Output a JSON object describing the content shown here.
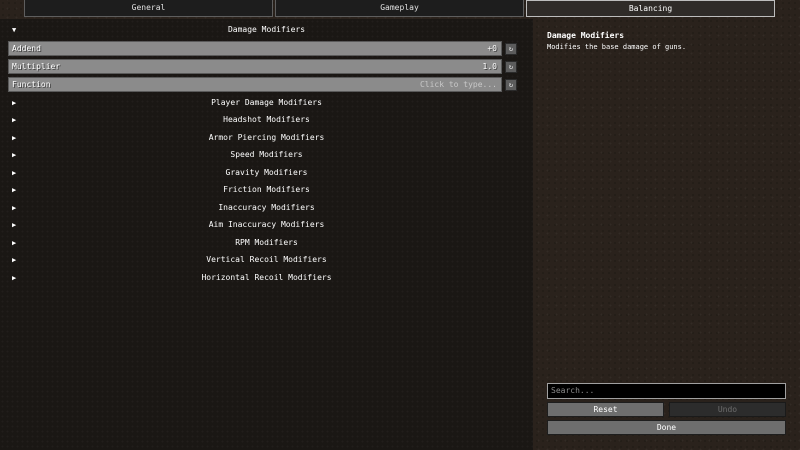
{
  "tabs": [
    {
      "label": "General"
    },
    {
      "label": "Gameplay"
    },
    {
      "label": "Balancing"
    }
  ],
  "section": {
    "title": "Damage Modifiers",
    "expanded_icon": "triangle-down-icon",
    "fields": [
      {
        "label": "Addend",
        "value": "+0",
        "reset_icon": "↻"
      },
      {
        "label": "Multiplier",
        "value": "1.0",
        "reset_icon": "↻"
      },
      {
        "label": "Function",
        "placeholder": "Click to type...",
        "reset_icon": "↻"
      }
    ]
  },
  "subsections": [
    {
      "label": "Player Damage Modifiers"
    },
    {
      "label": "Headshot Modifiers"
    },
    {
      "label": "Armor Piercing Modifiers"
    },
    {
      "label": "Speed Modifiers"
    },
    {
      "label": "Gravity Modifiers"
    },
    {
      "label": "Friction Modifiers"
    },
    {
      "label": "Inaccuracy Modifiers"
    },
    {
      "label": "Aim Inaccuracy Modifiers"
    },
    {
      "label": "RPM Modifiers"
    },
    {
      "label": "Vertical Recoil Modifiers"
    },
    {
      "label": "Horizontal Recoil Modifiers"
    }
  ],
  "collapsed_arrow": "▶",
  "expanded_arrow": "▼",
  "info": {
    "title": "Damage Modifiers",
    "description": "Modifies the base damage of guns."
  },
  "search": {
    "placeholder": "Search..."
  },
  "buttons": {
    "reset": "Reset",
    "undo": "Undo",
    "done": "Done"
  },
  "colors": {
    "background": "#2a221c",
    "panel": "#1a1714",
    "field": "#8b8b8b",
    "button": "#6e6e6e",
    "button_disabled": "#2c2c2c"
  }
}
